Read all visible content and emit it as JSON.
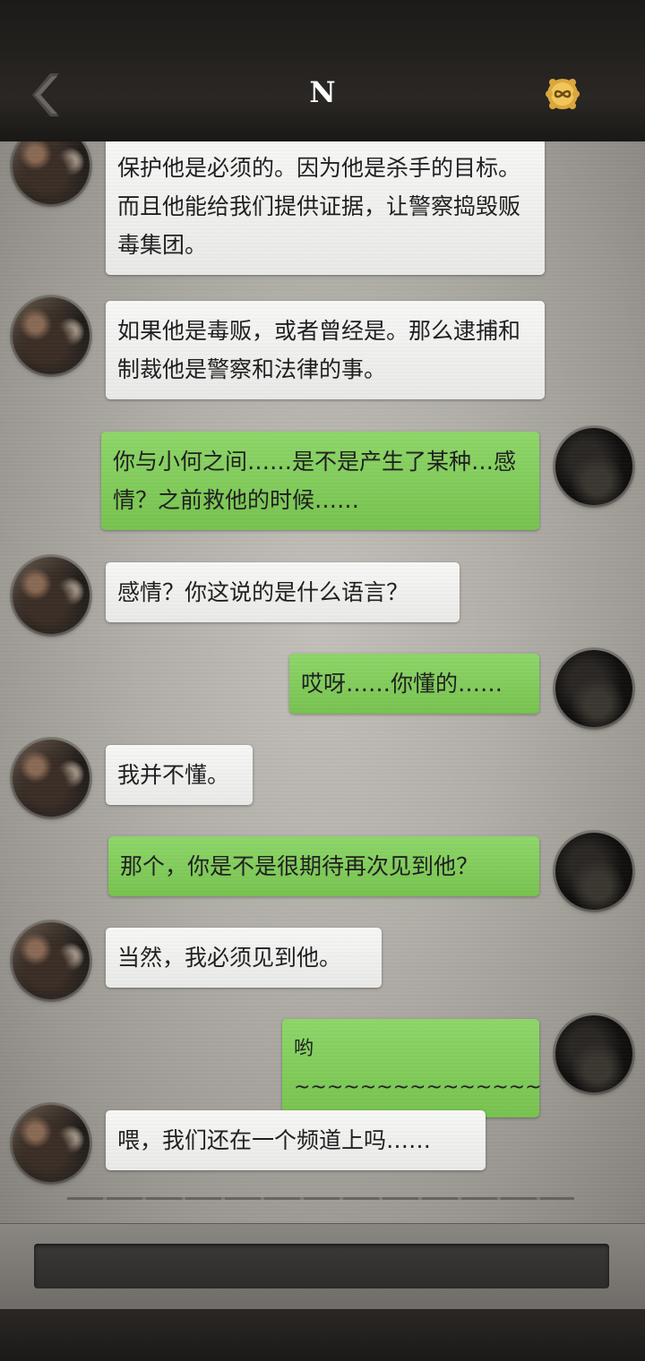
{
  "header": {
    "title": "N"
  },
  "messages": [
    {
      "from": "other",
      "text": "保护他是必须的。因为他是杀手的目标。而且他能给我们提供证据，让警察捣毁贩毒集团。"
    },
    {
      "from": "other",
      "text": "如果他是毒贩，或者曾经是。那么逮捕和制裁他是警察和法律的事。"
    },
    {
      "from": "self",
      "text": "你与小何之间……是不是产生了某种…感情？之前救他的时候……"
    },
    {
      "from": "other",
      "text": "感情？你这说的是什么语言？"
    },
    {
      "from": "self",
      "text": "哎呀……你懂的……"
    },
    {
      "from": "other",
      "text": "我并不懂。"
    },
    {
      "from": "self",
      "text": "那个，你是不是很期待再次见到他？"
    },
    {
      "from": "other",
      "text": "当然，我必须见到他。"
    },
    {
      "from": "self",
      "text": "哟~~~~~~~~~~~~~~~"
    },
    {
      "from": "other",
      "text": "喂，我们还在一个频道上吗……"
    }
  ],
  "colors": {
    "incoming_bubble": "#f4f4f3",
    "outgoing_bubble": "#82cc5c",
    "header_bg": "#24211f"
  },
  "icons": {
    "back": "chevron-left-icon",
    "badge": "infinity-badge-icon"
  }
}
